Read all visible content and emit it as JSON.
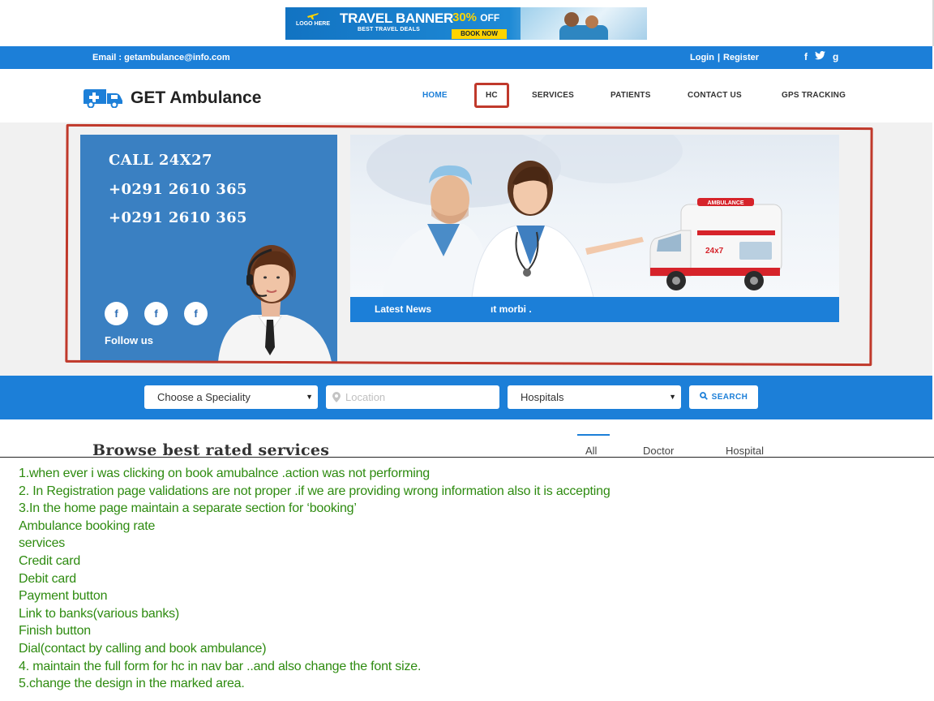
{
  "ad_banner": {
    "logo_text": "LOGO HERE",
    "title": "TRAVEL BANNER",
    "subtitle": "BEST TRAVEL DEALS",
    "discount": "30%",
    "discount_suffix": "OFF",
    "cta": "BOOK NOW"
  },
  "topbar": {
    "email": "Email : getambulance@info.com",
    "login": "Login",
    "separator": "|",
    "register": "Register",
    "social": [
      "f",
      "t",
      "g"
    ]
  },
  "brand": {
    "name": "GET Ambulance"
  },
  "nav": {
    "items": [
      {
        "label": "HOME",
        "active": true
      },
      {
        "label": "HC",
        "active": false
      },
      {
        "label": "SERVICES",
        "active": false
      },
      {
        "label": "PATIENTS",
        "active": false
      },
      {
        "label": "CONTACT US",
        "active": false
      },
      {
        "label": "GPS TRACKING",
        "active": false
      }
    ]
  },
  "hero": {
    "call_heading": "CALL 24X27",
    "phone_1": "+0291 2610 365",
    "phone_2": "+0291 2610 365",
    "social_buttons": [
      "f",
      "f",
      "f"
    ],
    "follow_label": "Follow us",
    "ambulance_sign": "AMBULANCE",
    "ambulance_badge": "24x7"
  },
  "news": {
    "label": "Latest News",
    "ticker": "ıt morbi ."
  },
  "search": {
    "speciality": "Choose a Speciality",
    "location_placeholder": "Location",
    "facility": "Hospitals",
    "button": "SEARCH"
  },
  "browse": {
    "title": "Browse best rated services",
    "tabs": [
      "All",
      "Doctor",
      "Hospital"
    ],
    "active_tab": "All"
  },
  "notes": [
    "1.when ever i was clicking on book amubalnce .action was not performing",
    "2. In Registration page validations are not proper .if we are providing wrong information also it is accepting",
    "3.In the home page maintain a separate section for ‘booking’",
    "Ambulance booking rate",
    "services",
    "Credit card",
    "Debit card",
    "Payment button",
    "Link to banks(various banks)",
    "Finish button",
    "Dial(contact by calling and book ambulance)",
    "4. maintain the full form for hc in nav bar ..and also change the font size.",
    "5.change the design in the marked area."
  ],
  "colors": {
    "primary_blue": "#1c7fd8",
    "panel_blue": "#3a80c2",
    "annotation_red": "#c0392b",
    "note_green": "#2e8b10"
  }
}
